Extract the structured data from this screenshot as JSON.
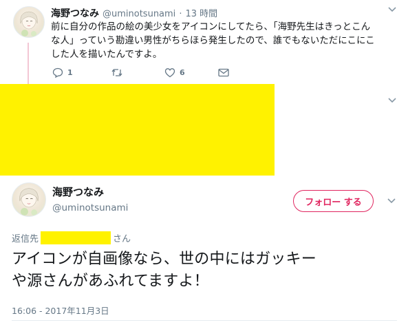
{
  "tweet1": {
    "display_name": "海野つなみ",
    "handle": "@uminotsunami",
    "separator": "·",
    "time": "13 時間",
    "text_lines": [
      "前に自分の作品の絵の美少女をアイコンにしてたら、「海野先生はきっとこん",
      "な人」っていう勘違い男性がちらほら発生したので、誰でもないただにこにこ",
      "した人を描いたんですよ。"
    ],
    "reply_count": "1",
    "retweet_count": "",
    "like_count": "6",
    "icons": [
      "reply-icon",
      "retweet-icon",
      "like-icon",
      "message-icon",
      "chevron-down-icon"
    ]
  },
  "tweet2": {
    "display_name": "海野つなみ",
    "handle": "@uminotsunami",
    "follow_label": "フォロー する",
    "reply_prefix": "返信先",
    "reply_suffix": "さん",
    "text_lines": [
      "アイコンが自画像なら、世の中にはガッキー",
      "や源さんがあふれてますよ！"
    ],
    "timestamp": "16:06 - 2017年11月3日"
  },
  "colors": {
    "accent": "#e0245e",
    "redaction": "#fff200",
    "thread_line": "#f3c6d4",
    "muted_text": "#657786"
  }
}
